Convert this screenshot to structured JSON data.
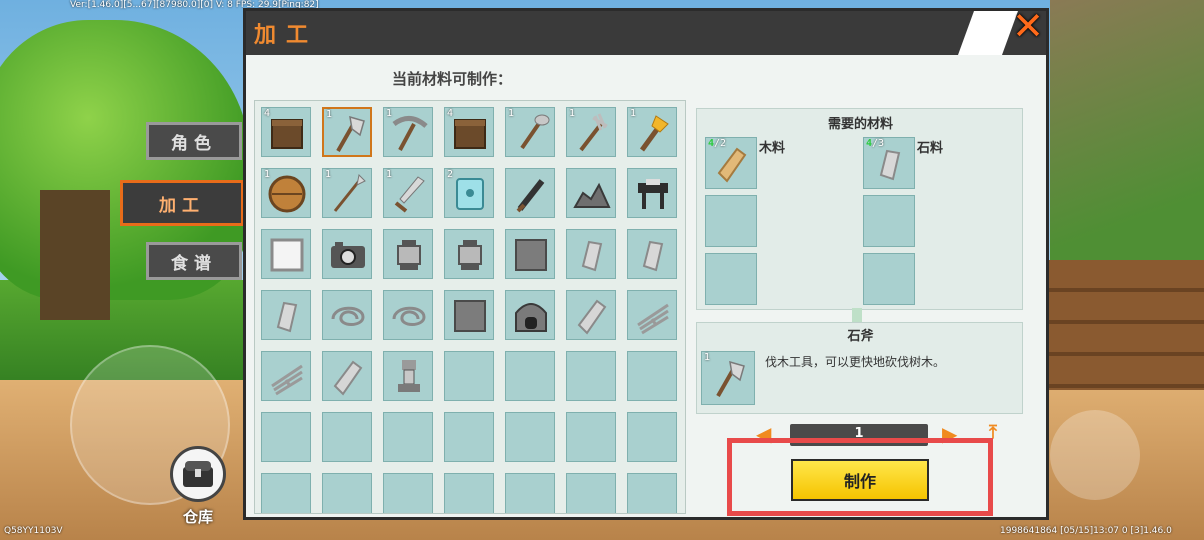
{
  "hud": {
    "debug_text": "Ver:[1.46.0][5...67][87980.0][0] V: 8 FPS: 29.9[Ping:82]",
    "bottom_left": "Q58YY1103V",
    "bottom_right": "1998641864    [05/15]13:07 0    [3]1.46.0"
  },
  "side_tabs": [
    {
      "label": "角色",
      "active": false
    },
    {
      "label": "加工",
      "active": true
    },
    {
      "label": "食谱",
      "active": false
    }
  ],
  "warehouse": {
    "label": "仓库"
  },
  "panel": {
    "title": "加工",
    "grid_caption": "当前材料可制作："
  },
  "grid_items": [
    {
      "icon": "wood-block-icon",
      "count": "4"
    },
    {
      "icon": "stone-axe-icon",
      "count": "1",
      "selected": true
    },
    {
      "icon": "pickaxe-icon",
      "count": "1"
    },
    {
      "icon": "wood-block-icon",
      "count": "4"
    },
    {
      "icon": "shovel-icon",
      "count": "1"
    },
    {
      "icon": "rake-icon",
      "count": "1"
    },
    {
      "icon": "torch-icon",
      "count": "1"
    },
    {
      "icon": "wooden-shield-icon",
      "count": "1"
    },
    {
      "icon": "spear-icon",
      "count": "1"
    },
    {
      "icon": "sword-icon",
      "count": "1"
    },
    {
      "icon": "safe-box-icon",
      "count": "2"
    },
    {
      "icon": "club-icon",
      "count": ""
    },
    {
      "icon": "stone-pile-icon",
      "count": ""
    },
    {
      "icon": "anvil-table-icon",
      "count": ""
    },
    {
      "icon": "frame-icon",
      "count": ""
    },
    {
      "icon": "camera-icon",
      "count": ""
    },
    {
      "icon": "lantern-icon",
      "count": ""
    },
    {
      "icon": "lantern-icon",
      "count": ""
    },
    {
      "icon": "stone-block-icon",
      "count": ""
    },
    {
      "icon": "stone-shard-icon",
      "count": ""
    },
    {
      "icon": "stone-shard-icon",
      "count": ""
    },
    {
      "icon": "stone-shard-icon",
      "count": ""
    },
    {
      "icon": "rope-icon",
      "count": ""
    },
    {
      "icon": "rope-icon",
      "count": ""
    },
    {
      "icon": "stone-block-icon",
      "count": ""
    },
    {
      "icon": "furnace-icon",
      "count": ""
    },
    {
      "icon": "plank-icon",
      "count": ""
    },
    {
      "icon": "straw-bundle-icon",
      "count": ""
    },
    {
      "icon": "straw-bundle-icon",
      "count": ""
    },
    {
      "icon": "plank-icon",
      "count": ""
    },
    {
      "icon": "stone-lamp-icon",
      "count": ""
    }
  ],
  "materials": {
    "title": "需要的材料",
    "items": [
      {
        "name": "木料",
        "have": "4",
        "need": "/2",
        "icon": "wood-plank-icon"
      },
      {
        "name": "石料",
        "have": "4",
        "need": "/3",
        "icon": "stone-shard-icon"
      }
    ]
  },
  "detail": {
    "name": "石斧",
    "count": "1",
    "description": "伐木工具，可以更快地砍伐树木。"
  },
  "quantity": {
    "value": "1"
  },
  "craft_button": {
    "label": "制作"
  },
  "colors": {
    "accent": "#f08a30",
    "highlight": "#e84a4a",
    "craft": "#ffd91a",
    "slot": "#a9d0cf"
  }
}
